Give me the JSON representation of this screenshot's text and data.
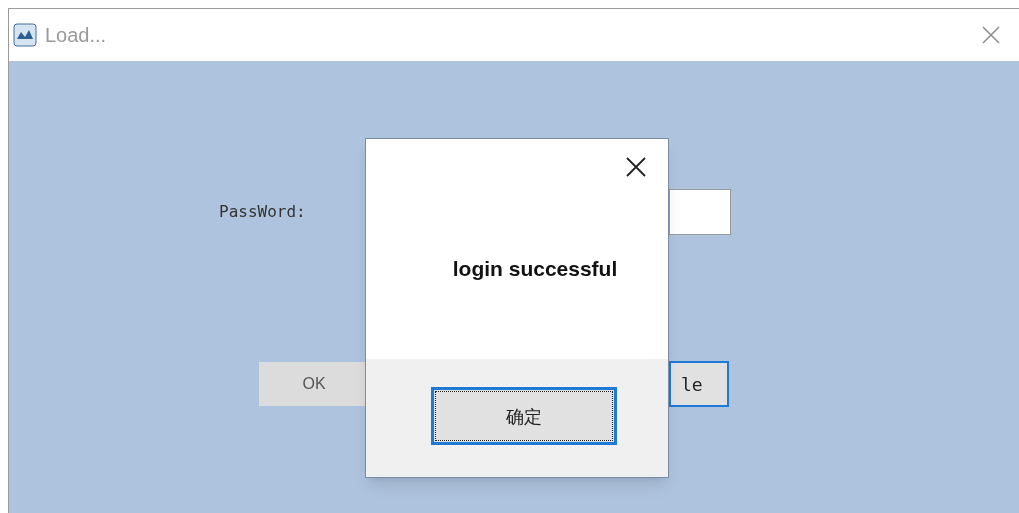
{
  "window": {
    "title": "Load..."
  },
  "form": {
    "password_label": "PassWord:",
    "ok_button": "OK",
    "second_button": "le"
  },
  "dialog": {
    "message": "login successful",
    "confirm_button": "确定"
  }
}
